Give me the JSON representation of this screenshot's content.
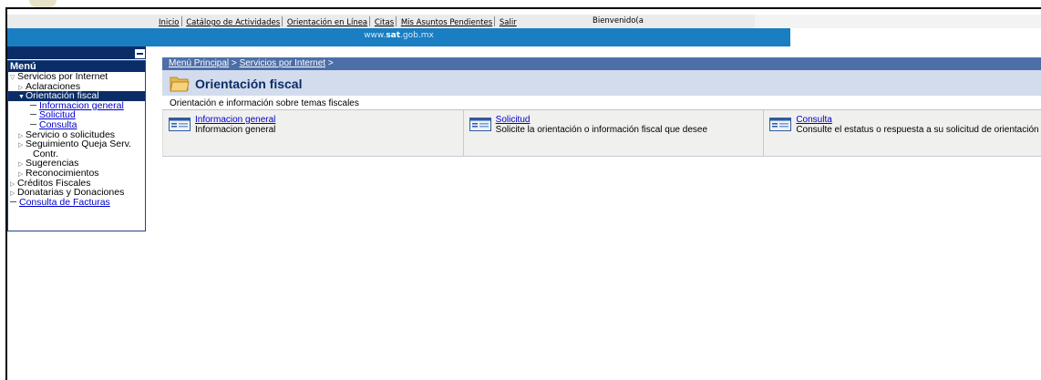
{
  "topnav": {
    "links": [
      "Inicio",
      "Catálogo de Actividades",
      "Orientación en Línea",
      "Citas",
      "Mis Asuntos Pendientes",
      "Salir"
    ],
    "welcome": "Bienvenido(a"
  },
  "site_domain_prefix": "www.",
  "site_domain_bold": "sat",
  "site_domain_suffix": ".gob.mx",
  "menu": {
    "title": "Menú",
    "items": [
      {
        "label": "Servicios por Internet",
        "level": 0,
        "marker": "open"
      },
      {
        "label": "Aclaraciones",
        "level": 1,
        "marker": "closed"
      },
      {
        "label": "Orientación fiscal",
        "level": 1,
        "marker": "open",
        "selected": true
      },
      {
        "label": "Informacion general",
        "level": 2,
        "marker": "dash",
        "link": true
      },
      {
        "label": "Solicitud",
        "level": 2,
        "marker": "dash",
        "link": true
      },
      {
        "label": "Consulta",
        "level": 2,
        "marker": "dash",
        "link": true
      },
      {
        "label": "Servicio o solicitudes",
        "level": 1,
        "marker": "closed"
      },
      {
        "label": "Seguimiento Queja Serv.",
        "level": 1,
        "marker": "closed"
      },
      {
        "label": "Contr.",
        "level": 1,
        "marker": "none",
        "indent_extra": true
      },
      {
        "label": "Sugerencias",
        "level": 1,
        "marker": "closed"
      },
      {
        "label": "Reconocimientos",
        "level": 1,
        "marker": "closed"
      },
      {
        "label": "Créditos Fiscales",
        "level": 0,
        "marker": "closed"
      },
      {
        "label": "Donatarias y Donaciones",
        "level": 0,
        "marker": "closed"
      },
      {
        "label": "Consulta de Facturas",
        "level": 0,
        "marker": "dash",
        "link": true
      }
    ]
  },
  "breadcrumb": {
    "part1": "Menú Principal",
    "sep1": " > ",
    "part2": "Servicios por Internet",
    "sep2": " >"
  },
  "page_title": "Orientación fiscal",
  "subtitle": "Orientación e información sobre temas fiscales",
  "cards": [
    {
      "title": "Informacion general",
      "description": "Informacion general"
    },
    {
      "title": "Solicitud",
      "description": "Solicite la orientación o información fiscal que desee"
    },
    {
      "title": "Consulta",
      "description": "Consulte el estatus o respuesta a su solicitud de orientación fiscal"
    }
  ],
  "colors": {
    "menu_dark": "#0b2d67",
    "sat_blue": "#1a7ec3",
    "breadcrumb_bg": "#4d6fa8",
    "title_bg": "#d3dced",
    "link": "#0000cc"
  }
}
